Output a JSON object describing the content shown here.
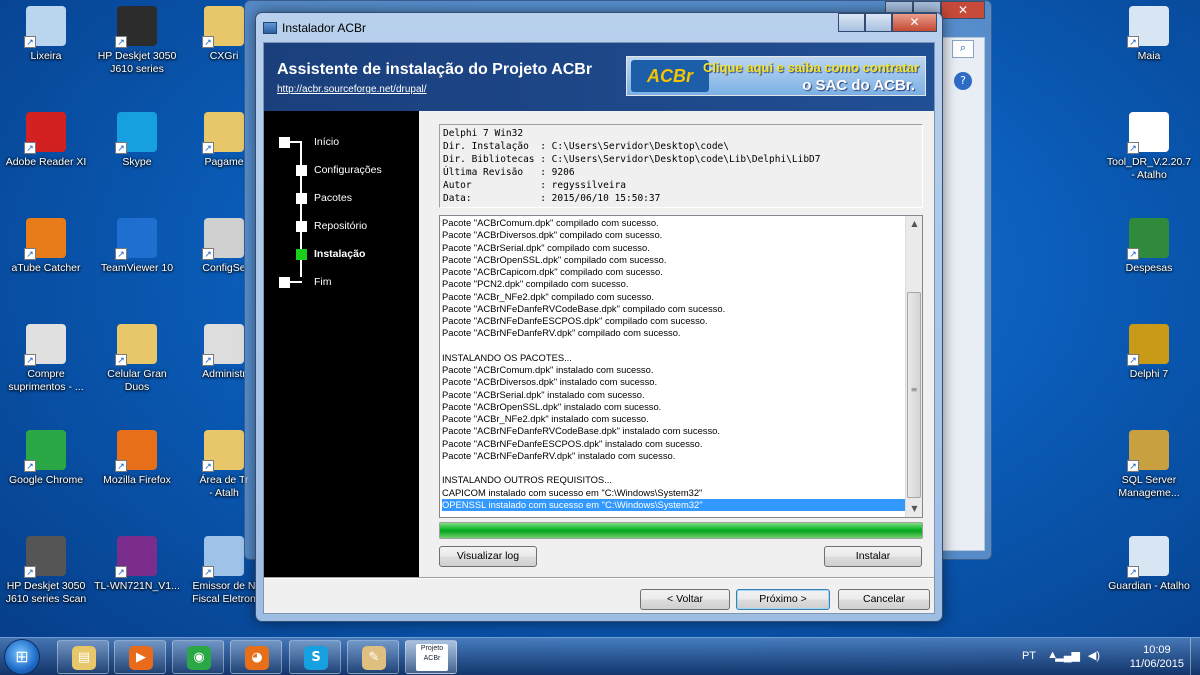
{
  "desktop": {
    "left_icons": [
      {
        "label": "Lixeira",
        "icon": "recycle-bin-icon",
        "color": "#b9d6ee"
      },
      {
        "label": "HP Deskjet 3050\nJ610 series",
        "icon": "printer-icon",
        "color": "#2c2c2c"
      },
      {
        "label": "CXGri",
        "icon": "folder-icon",
        "color": "#e8c66a"
      },
      {
        "label": "Adobe Reader XI",
        "icon": "pdf-icon",
        "color": "#d32020"
      },
      {
        "label": "Skype",
        "icon": "skype-icon",
        "color": "#16a0e0"
      },
      {
        "label": "Pagame",
        "icon": "folder-icon",
        "color": "#e8c66a"
      },
      {
        "label": "aTube Catcher",
        "icon": "atube-icon",
        "color": "#e87c1a"
      },
      {
        "label": "TeamViewer 10",
        "icon": "teamviewer-icon",
        "color": "#1e6fd0"
      },
      {
        "label": "ConfigSe",
        "icon": "document-icon",
        "color": "#d0d0d0"
      },
      {
        "label": "Compre\nsuprimentos - ...",
        "icon": "hp-supplies-icon",
        "color": "#e0e0e0"
      },
      {
        "label": "Celular Gran\nDuos",
        "icon": "folder-zip-icon",
        "color": "#e8c66a"
      },
      {
        "label": "Administr",
        "icon": "window-icon",
        "color": "#dddddd"
      },
      {
        "label": "Google Chrome",
        "icon": "chrome-icon",
        "color": "#2aa846"
      },
      {
        "label": "Mozilla Firefox",
        "icon": "firefox-icon",
        "color": "#e86f1a"
      },
      {
        "label": "Área de Tr\n- Atalh",
        "icon": "folder-icon",
        "color": "#e8c66a"
      },
      {
        "label": "HP Deskjet 3050\nJ610 series Scan",
        "icon": "scanner-icon",
        "color": "#555555"
      },
      {
        "label": "TL-WN721N_V1...",
        "icon": "winrar-icon",
        "color": "#7a2d8c"
      },
      {
        "label": "Emissor de N\nFiscal Eletron",
        "icon": "nfe-icon",
        "color": "#9ec2e8"
      }
    ],
    "right_icons": [
      {
        "label": "Maia",
        "icon": "shortcut-app-icon",
        "color": "#d8e6f4"
      },
      {
        "label": "Tool_DR_V.2.20.7\n- Atalho",
        "icon": "urmet-icon",
        "color": "#ffffff"
      },
      {
        "label": "Despesas",
        "icon": "excel-icon",
        "color": "#2f8a3c"
      },
      {
        "label": "Delphi 7",
        "icon": "delphi-icon",
        "color": "#c89a18"
      },
      {
        "label": "SQL Server\nManageme...",
        "icon": "sql-server-icon",
        "color": "#c8a040"
      },
      {
        "label": "Guardian - Atalho",
        "icon": "shortcut-app-icon",
        "color": "#d8e6f4"
      }
    ]
  },
  "window": {
    "title": "Instalador ACBr",
    "header_title": "Assistente de instalação do Projeto ACBr",
    "header_url": "http://acbr.sourceforge.net/drupal/",
    "banner_logo": "ACBr",
    "banner_line1": "Clique aqui e saiba como contratar",
    "banner_line2": "o SAC do ACBr."
  },
  "steps": [
    {
      "label": "Início",
      "active": false
    },
    {
      "label": "Configurações",
      "active": false
    },
    {
      "label": "Pacotes",
      "active": false
    },
    {
      "label": "Repositório",
      "active": false
    },
    {
      "label": "Instalação",
      "active": true
    },
    {
      "label": "Fim",
      "active": false
    }
  ],
  "info": [
    "Delphi 7 Win32",
    "Dir. Instalação  : C:\\Users\\Servidor\\Desktop\\code\\",
    "Dir. Bibliotecas : C:\\Users\\Servidor\\Desktop\\code\\Lib\\Delphi\\LibD7",
    "Última Revisão   : 9206",
    "Autor            : regyssilveira",
    "Data:            : 2015/06/10 15:50:37"
  ],
  "log": [
    "Pacote \"ACBrComum.dpk\" compilado com sucesso.",
    "Pacote \"ACBrDiversos.dpk\" compilado com sucesso.",
    "Pacote \"ACBrSerial.dpk\" compilado com sucesso.",
    "Pacote \"ACBrOpenSSL.dpk\" compilado com sucesso.",
    "Pacote \"ACBrCapicom.dpk\" compilado com sucesso.",
    "Pacote \"PCN2.dpk\" compilado com sucesso.",
    "Pacote \"ACBr_NFe2.dpk\" compilado com sucesso.",
    "Pacote \"ACBrNFeDanfeRVCodeBase.dpk\" compilado com sucesso.",
    "Pacote \"ACBrNFeDanfeESCPOS.dpk\" compilado com sucesso.",
    "Pacote \"ACBrNFeDanfeRV.dpk\" compilado com sucesso.",
    "",
    "INSTALANDO OS PACOTES...",
    "Pacote \"ACBrComum.dpk\" instalado com sucesso.",
    "Pacote \"ACBrDiversos.dpk\" instalado com sucesso.",
    "Pacote \"ACBrSerial.dpk\" instalado com sucesso.",
    "Pacote \"ACBrOpenSSL.dpk\" instalado com sucesso.",
    "Pacote \"ACBr_NFe2.dpk\" instalado com sucesso.",
    "Pacote \"ACBrNFeDanfeRVCodeBase.dpk\" instalado com sucesso.",
    "Pacote \"ACBrNFeDanfeESCPOS.dpk\" instalado com sucesso.",
    "Pacote \"ACBrNFeDanfeRV.dpk\" instalado com sucesso.",
    "",
    "INSTALANDO OUTROS REQUISITOS...",
    "CAPICOM instalado com sucesso em \"C:\\Windows\\System32\"",
    "OPENSSL instalado com sucesso em \"C:\\Windows\\System32\""
  ],
  "log_selected_index": 23,
  "progress_fraction": 1.0,
  "buttons": {
    "view_log": "Visualizar log",
    "install": "Instalar",
    "back": "< Voltar",
    "next": "Próximo >",
    "cancel": "Cancelar"
  },
  "taskbar": {
    "apps": [
      {
        "name": "explorer",
        "icon": "folder-icon",
        "color": "#e8c66a"
      },
      {
        "name": "media",
        "icon": "media-player-icon",
        "color": "#e86a1a"
      },
      {
        "name": "chrome",
        "icon": "chrome-icon",
        "color": "#2aa846"
      },
      {
        "name": "firefox",
        "icon": "firefox-icon",
        "color": "#e86f1a"
      },
      {
        "name": "skype",
        "icon": "skype-icon",
        "color": "#16a0e0"
      },
      {
        "name": "paint",
        "icon": "paint-icon",
        "color": "#e0c080"
      }
    ],
    "active_app_label": "Projeto\nACBr",
    "language": "PT",
    "time": "10:09",
    "date": "11/06/2015"
  }
}
